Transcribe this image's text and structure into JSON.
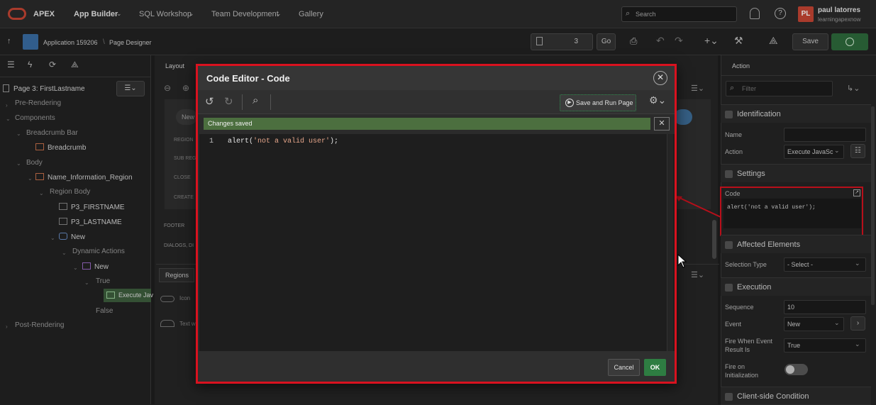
{
  "topbar": {
    "brand": "APEX",
    "nav": [
      "App Builder",
      "SQL Workshop",
      "Team Development",
      "Gallery"
    ],
    "search_placeholder": "Search",
    "avatar_initials": "PL",
    "user_name": "paul latorres",
    "user_workspace": "learningapexnow"
  },
  "bar2": {
    "application": "Application 159206",
    "separator": "\\",
    "page_designer": "Page Designer",
    "page_number": "3",
    "go_label": "Go",
    "save_label": "Save"
  },
  "left_pane": {
    "page_title": "Page 3: FirstLastname",
    "tree": [
      "Pre-Rendering",
      "Components",
      "Breadcrumb Bar",
      "Breadcrumb",
      "Body",
      "Name_Information_Region",
      "Region Body",
      "P3_FIRSTNAME",
      "P3_LASTNAME",
      "New",
      "Dynamic Actions",
      "New",
      "True",
      "Execute Jav",
      "False",
      "Post-Rendering"
    ]
  },
  "center": {
    "tab_layout": "Layout",
    "new_label": "New",
    "rows": [
      "REGION",
      "SUB REG",
      "CLOSE",
      "CREATE"
    ],
    "footer": "FOOTER",
    "dialogs": "DIALOGS, DI",
    "regions_tab": "Regions",
    "gallery_items": [
      "Icon",
      "Text w"
    ]
  },
  "right_pane": {
    "tab_action": "Action",
    "filter_placeholder": "Filter",
    "sections": {
      "identification": "Identification",
      "settings": "Settings",
      "affected": "Affected Elements",
      "execution": "Execution",
      "client_side": "Client-side Condition"
    },
    "name_label": "Name",
    "name_value": "",
    "action_label": "Action",
    "action_value": "Execute JavaSc",
    "code_label": "Code",
    "code_value": "alert('not a valid user');",
    "selection_type_label": "Selection Type",
    "selection_type_value": "- Select -",
    "sequence_label": "Sequence",
    "sequence_value": "10",
    "event_label": "Event",
    "event_value": "New",
    "fire_when_label": "Fire When Event Result Is",
    "fire_when_value": "True",
    "fire_init_label": "Fire on Initialization"
  },
  "modal": {
    "title": "Code Editor - Code",
    "save_run_label": "Save and Run Page",
    "changes_saved": "Changes saved",
    "line_number": "1",
    "code_prefix": "alert(",
    "code_string": "'not a valid user'",
    "code_suffix": ");",
    "cancel_label": "Cancel",
    "ok_label": "OK"
  },
  "colors": {
    "accent_red": "#d9121f",
    "oracle_red": "#c74634",
    "success_green": "#2e7d42",
    "banner_green": "#4c6f3f"
  }
}
